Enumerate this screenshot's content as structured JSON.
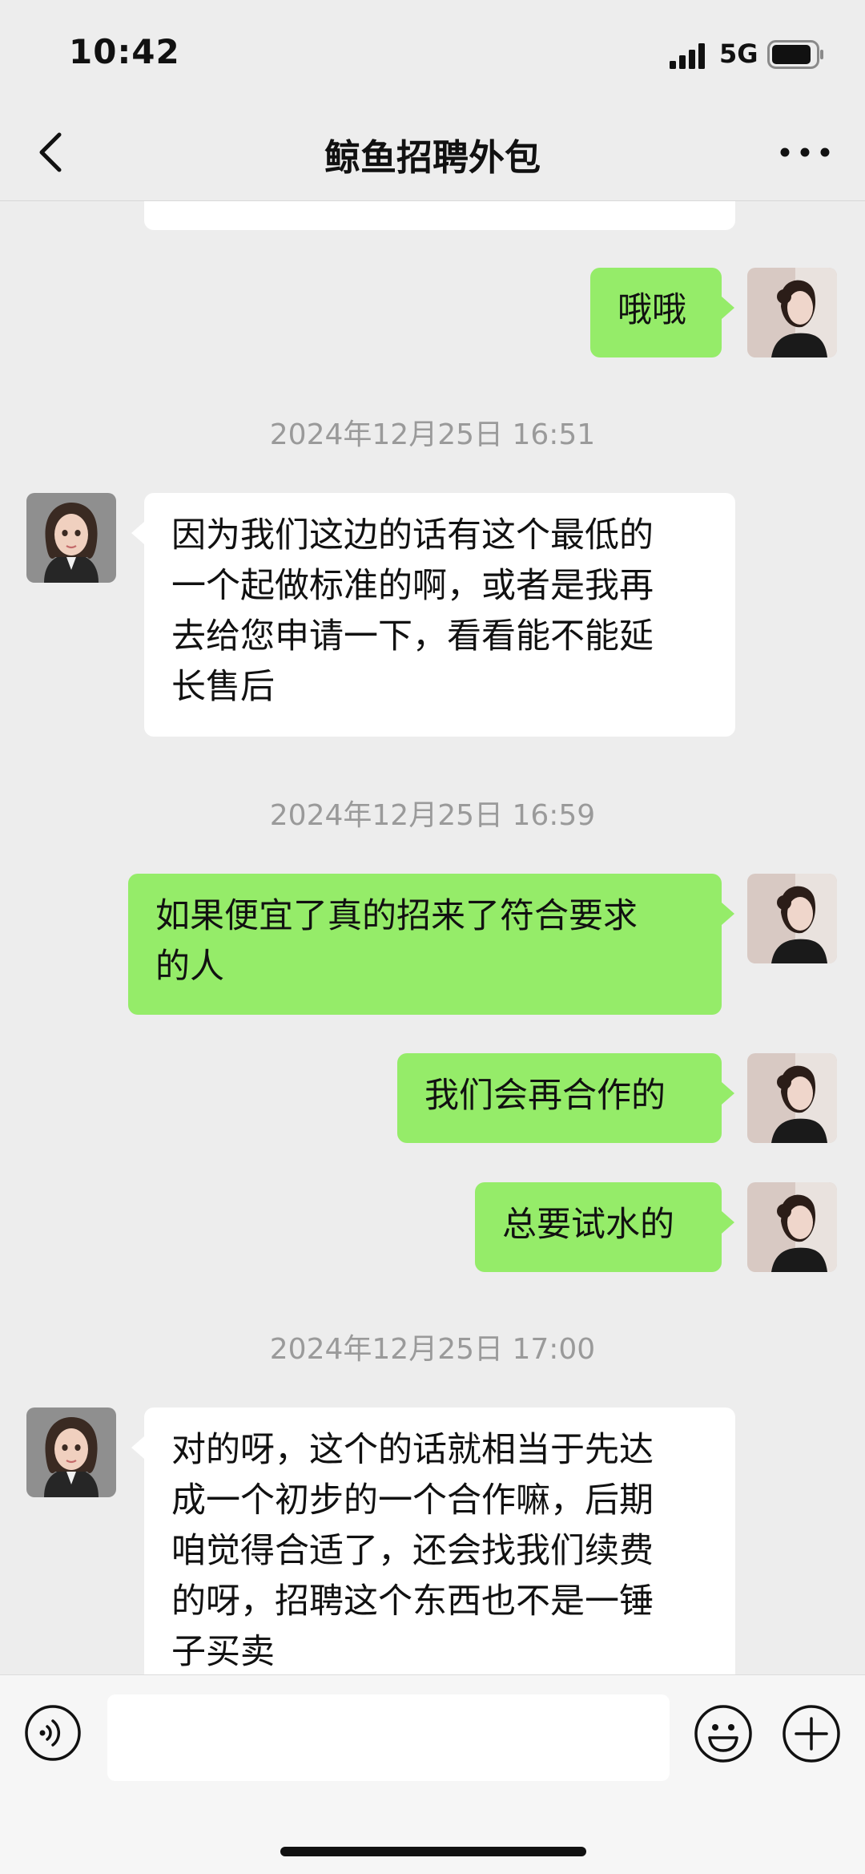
{
  "status_bar": {
    "time": "10:42",
    "network": "5G"
  },
  "header": {
    "title": "鲸鱼招聘外包"
  },
  "messages": [
    {
      "side": "out",
      "text": "哦哦"
    },
    {
      "type": "timestamp",
      "text": "2024年12月25日 16:51"
    },
    {
      "side": "in",
      "lines": [
        "因为我们这边的话有这个最低的",
        "一个起做标准的啊，或者是我再",
        "去给您申请一下，看看能不能延",
        "长售后"
      ]
    },
    {
      "type": "timestamp",
      "text": "2024年12月25日 16:59"
    },
    {
      "side": "out",
      "lines": [
        "如果便宜了真的招来了符合要求",
        "的人"
      ]
    },
    {
      "side": "out",
      "text": "我们会再合作的"
    },
    {
      "side": "out",
      "text": "总要试水的"
    },
    {
      "type": "timestamp",
      "text": "2024年12月25日 17:00"
    },
    {
      "side": "in",
      "lines": [
        "对的呀，这个的话就相当于先达",
        "成一个初步的一个合作嘛，后期",
        "咱觉得合适了，还会找我们续费",
        "的呀，招聘这个东西也不是一锤",
        "子买卖"
      ]
    }
  ],
  "input": {
    "value": ""
  },
  "icons": {
    "back": "chevron-left-icon",
    "more": "more-dots-icon",
    "voice": "voice-icon",
    "emoji": "emoji-icon",
    "plus": "plus-icon",
    "signal": "signal-icon",
    "battery": "battery-icon"
  },
  "colors": {
    "background": "#ededed",
    "outgoing_bubble": "#95ec69",
    "incoming_bubble": "#ffffff",
    "timestamp": "#9a9a9a"
  }
}
